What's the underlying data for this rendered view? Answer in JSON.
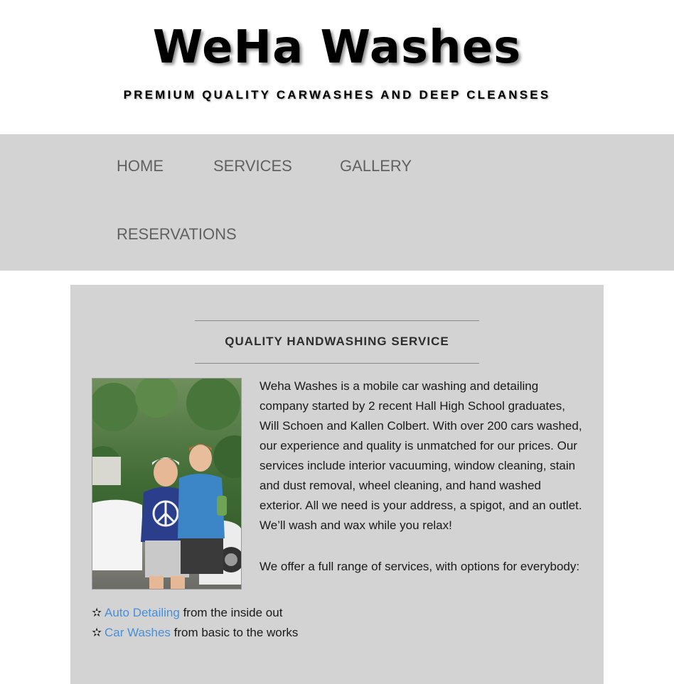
{
  "header": {
    "title": "WeHa Washes",
    "tagline": "PREMIUM QUALITY CARWASHES AND DEEP CLEANSES"
  },
  "nav": {
    "items": [
      {
        "label": "HOME"
      },
      {
        "label": "SERVICES"
      },
      {
        "label": "GALLERY"
      },
      {
        "label": "RESERVATIONS"
      }
    ]
  },
  "main": {
    "heading": "QUALITY HANDWASHING SERVICE",
    "paragraph_1": "Weha Washes is a mobile car washing and detailing company started by 2 recent Hall High School graduates, Will Schoen and Kallen Colbert. With over 200 cars washed, our experience and quality is unmatched for our prices. Our services include interior vacuuming, window cleaning, stain and dust removal, wheel cleaning, and hand washed exterior. All we need is your address, a spigot, and an outlet. We’ll wash and wax while you relax!",
    "paragraph_2": "We offer a full range of services, with options for everybody:",
    "services": [
      {
        "link": "Auto Detailing",
        "text": " from the inside out"
      },
      {
        "link": "Car Washes",
        "text": " from basic to the works"
      }
    ],
    "bullet_glyph": "✫"
  },
  "colors": {
    "nav_background": "#d3d3d3",
    "nav_text": "#616161",
    "link": "#4a8fd4"
  },
  "icons": {
    "bullet": "star-outline-icon"
  }
}
